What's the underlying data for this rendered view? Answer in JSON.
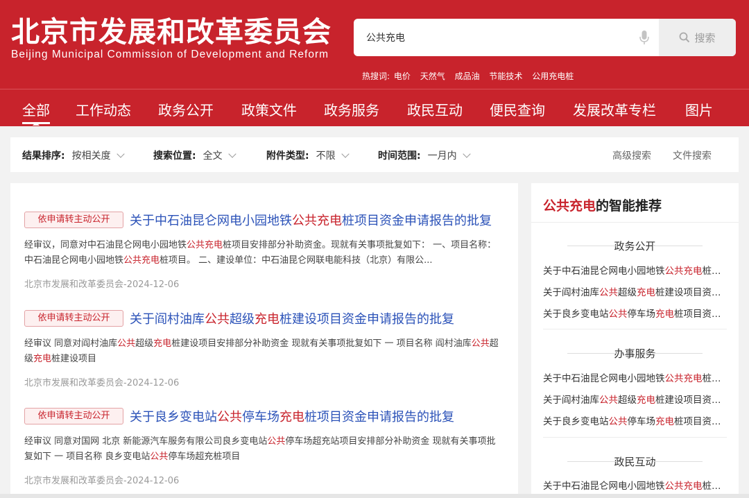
{
  "header": {
    "title": "北京市发展和改革委员会",
    "subtitle": "Beijing Municipal Commission of Development and Reform"
  },
  "search": {
    "value": "公共充电",
    "button_label": "搜索",
    "hot_label": "热搜词:",
    "hot_words": [
      "电价",
      "天然气",
      "成品油",
      "节能技术",
      "公用充电桩"
    ]
  },
  "nav": {
    "items": [
      "全部",
      "工作动态",
      "政务公开",
      "政策文件",
      "政务服务",
      "政民互动",
      "便民查询",
      "发展改革专栏",
      "图片"
    ],
    "active": "全部"
  },
  "filters": {
    "sort": {
      "label": "结果排序:",
      "value": "按相关度"
    },
    "location": {
      "label": "搜索位置:",
      "value": "全文"
    },
    "attachment": {
      "label": "附件类型:",
      "value": "不限"
    },
    "time": {
      "label": "时间范围:",
      "value": "一月内"
    },
    "advanced": "高级搜索",
    "file_search": "文件搜索"
  },
  "results": [
    {
      "tag": "依申请转主动公开",
      "title": [
        "关于中石油昆仑网电小园地铁",
        "公共充电",
        "桩项目资金申请报告的批复"
      ],
      "snippet": [
        "经审议，同意对中石油昆仑网电小园地铁",
        "公共充电",
        "桩项目安排部分补助资金。现就有关事项批复如下： 一、项目名称：中石油昆仑网电小园地铁",
        "公共充电",
        "桩项目。 二、建设单位：中石油昆仑网联电能科技（北京）有限公..."
      ],
      "source": "北京市发展和改革委员会-2024-12-06"
    },
    {
      "tag": "依申请转主动公开",
      "title": [
        "关于阎村油库",
        "公共",
        "超级",
        "充电",
        "桩建设项目资金申请报告的批复"
      ],
      "snippet": [
        "经审议 同意对阎村油库",
        "公共",
        "超级",
        "充电",
        "桩建设项目安排部分补助资金 现就有关事项批复如下 一 项目名称 阎村油库",
        "公共",
        "超级",
        "充电",
        "桩建设项目"
      ],
      "source": "北京市发展和改革委员会-2024-12-06"
    },
    {
      "tag": "依申请转主动公开",
      "title": [
        "关于良乡变电站",
        "公共",
        "停车场",
        "充电",
        "桩项目资金申请报告的批复"
      ],
      "snippet": [
        "经审议 同意对国网 北京 新能源汽车服务有限公司良乡变电站",
        "公共",
        "停车场超充站项目安排部分补助资金 现就有关事项批复如下 一 项目名称 良乡变电站",
        "公共",
        "停车场超充桩项目"
      ],
      "source": "北京市发展和改革委员会-2024-12-06"
    }
  ],
  "recommend": {
    "title_highlight": "公共充电",
    "title_rest": "的智能推荐",
    "sections": [
      {
        "heading": "政务公开",
        "items": [
          [
            "关于中石油昆仑网电小园地铁",
            "公共充电",
            "桩项目资金申请报告的批复"
          ],
          [
            "关于阎村油库",
            "公共",
            "超级",
            "充电",
            "桩建设项目资金申请报告的批复"
          ],
          [
            "关于良乡变电站",
            "公共",
            "停车场",
            "充电",
            "桩项目资金申请报告的批复"
          ]
        ]
      },
      {
        "heading": "办事服务",
        "items": [
          [
            "关于中石油昆仑网电小园地铁",
            "公共充电",
            "桩项目资金申请报告的批复"
          ],
          [
            "关于阎村油库",
            "公共",
            "超级",
            "充电",
            "桩建设项目资金申请报告的批复"
          ],
          [
            "关于良乡变电站",
            "公共",
            "停车场",
            "充电",
            "桩项目资金申请报告的批复"
          ]
        ]
      },
      {
        "heading": "政民互动",
        "items": [
          [
            "关于中石油昆仑网电小园地铁",
            "公共充电",
            "桩项目资金申请报告的批复"
          ]
        ]
      }
    ]
  },
  "colors": {
    "brand_red": "#c8232c",
    "link_blue": "#2b52b8"
  }
}
